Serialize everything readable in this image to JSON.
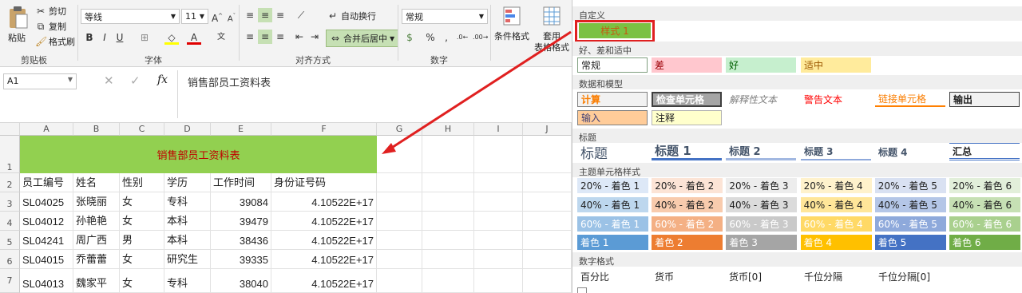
{
  "ribbon": {
    "paste": "粘贴",
    "cut": "剪切",
    "copy": "复制",
    "format_painter": "格式刷",
    "clipboard": "剪贴板",
    "font_name": "等线",
    "font_size": "11",
    "font_group": "字体",
    "wrap_text": "自动换行",
    "merge_center": "合并后居中",
    "align_group": "对齐方式",
    "number_format": "常规",
    "number_group": "数字",
    "cond_format": "条件格式",
    "table_format_1": "套用",
    "table_format_2": "表格格式"
  },
  "formula": {
    "cell_ref": "A1",
    "fx": "fx",
    "content": "销售部员工资料表"
  },
  "columns": [
    "A",
    "B",
    "C",
    "D",
    "E",
    "F",
    "G",
    "H",
    "I",
    "J"
  ],
  "rows": [
    "1",
    "2",
    "3",
    "4",
    "5",
    "6",
    "7"
  ],
  "title_cell": "销售部员工资料表",
  "headers": [
    "员工编号",
    "姓名",
    "性别",
    "学历",
    "工作时间",
    "身份证号码"
  ],
  "data": [
    [
      "SL04025",
      "张晓丽",
      "女",
      "专科",
      "39084",
      "4.10522E+17"
    ],
    [
      "SL04012",
      "孙艳艳",
      "女",
      "本科",
      "39479",
      "4.10522E+17"
    ],
    [
      "SL04241",
      "周广西",
      "男",
      "本科",
      "38436",
      "4.10522E+17"
    ],
    [
      "SL04015",
      "乔蕾蕾",
      "女",
      "研究生",
      "39335",
      "4.10522E+17"
    ],
    [
      "SL04013",
      "魏家平",
      "女",
      "专科",
      "38040",
      "4.10522E+17"
    ]
  ],
  "panel": {
    "custom": "自定义",
    "style1": "样式 1",
    "good_bad": "好、差和适中",
    "normal": "常规",
    "bad": "差",
    "good": "好",
    "neutral": "适中",
    "data_model": "数据和模型",
    "calc": "计算",
    "check": "检查单元格",
    "explain": "解释性文本",
    "warn": "警告文本",
    "linked": "链接单元格",
    "output": "输出",
    "input": "输入",
    "note": "注释",
    "titles": "标题",
    "title": "标题",
    "h1": "标题 1",
    "h2": "标题 2",
    "h3": "标题 3",
    "h4": "标题 4",
    "total": "汇总",
    "theme": "主题单元格样式",
    "t20": [
      "20% - 着色 1",
      "20% - 着色 2",
      "20% - 着色 3",
      "20% - 着色 4",
      "20% - 着色 5",
      "20% - 着色 6"
    ],
    "t40": [
      "40% - 着色 1",
      "40% - 着色 2",
      "40% - 着色 3",
      "40% - 着色 4",
      "40% - 着色 5",
      "40% - 着色 6"
    ],
    "t60": [
      "60% - 着色 1",
      "60% - 着色 2",
      "60% - 着色 3",
      "60% - 着色 4",
      "60% - 着色 5",
      "60% - 着色 6"
    ],
    "tfull": [
      "着色 1",
      "着色 2",
      "着色 3",
      "着色 4",
      "着色 5",
      "着色 6"
    ],
    "numfmt": "数字格式",
    "percent": "百分比",
    "currency": "货币",
    "currency0": "货币[0]",
    "comma": "千位分隔",
    "comma0": "千位分隔[0]"
  },
  "colors": {
    "title_fill": "#92d050",
    "title_text": "#c00000",
    "highlight": "#e02020",
    "style1_fill": "#7bc143",
    "style1_text": "#c65911"
  }
}
